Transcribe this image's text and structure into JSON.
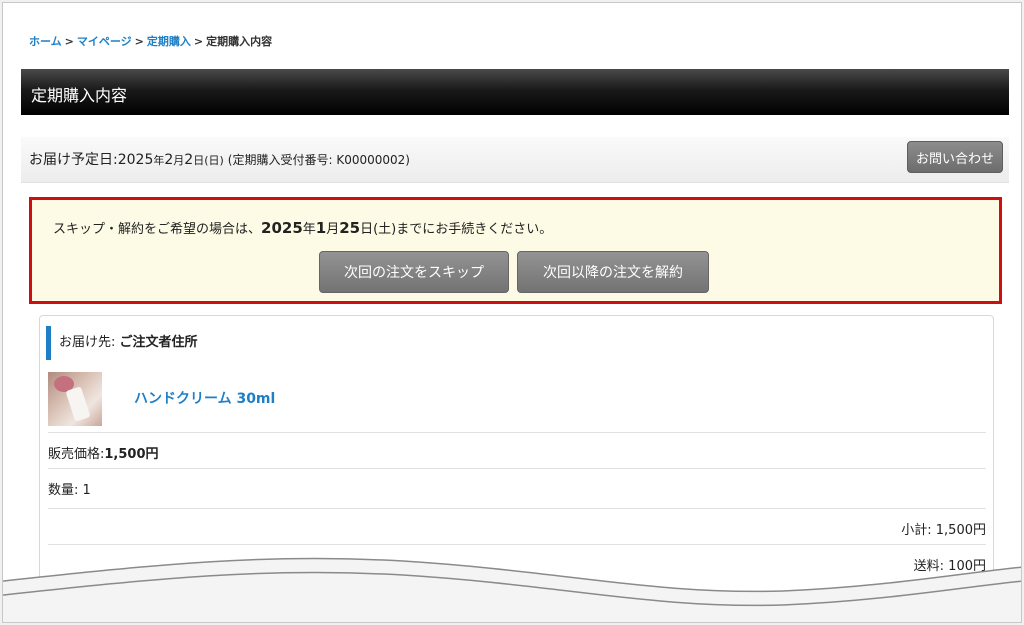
{
  "breadcrumb": {
    "home": "ホーム",
    "mypage": "マイページ",
    "subscription": "定期購入",
    "current": "定期購入内容",
    "separator": ">"
  },
  "page_title": "定期購入内容",
  "delivery": {
    "label": "お届け予定日:",
    "year": "2025",
    "year_unit": "年",
    "month": "2",
    "month_unit": "月",
    "day": "2",
    "day_unit": "日(日)",
    "ticket": "(定期購入受付番号: K00000002)",
    "contact_button": "お問い合わせ"
  },
  "notice": {
    "prefix": "スキップ・解約をご希望の場合は、",
    "deadline_year": "2025",
    "deadline_year_unit": "年",
    "deadline_month": "1",
    "deadline_month_unit": "月",
    "deadline_day": "25",
    "deadline_day_unit": "日(土)",
    "suffix": "までにお手続きください。",
    "skip_button": "次回の注文をスキップ",
    "cancel_button": "次回以降の注文を解約"
  },
  "order": {
    "destination_label": "お届け先:",
    "destination_value": "ご注文者住所",
    "product_name": "ハンドクリーム 30ml",
    "price_label": "販売価格:",
    "price_value": "1,500円",
    "quantity_label": "数量:",
    "quantity_value": "1",
    "subtotal": "小計: 1,500円",
    "shipping": "送料: 100円"
  },
  "colors": {
    "link": "#1f7fc6",
    "notice_border": "#cc1010",
    "notice_bg": "#fdfbe6",
    "titlebar": "#000000",
    "button": "#7a7a7a"
  },
  "icons": {
    "product_image": "hand-cream-photo"
  }
}
